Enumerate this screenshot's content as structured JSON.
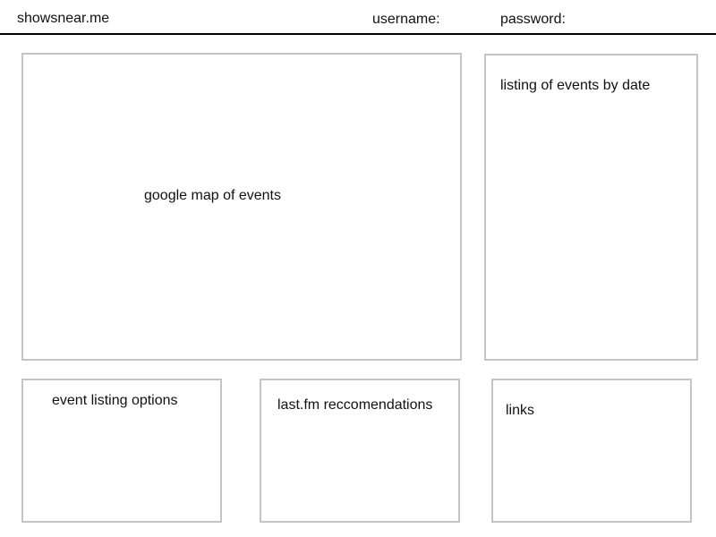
{
  "header": {
    "site_name": "showsnear.me",
    "username_label": "username:",
    "password_label": "password:"
  },
  "panels": {
    "map": "google map of events",
    "event_listing": "listing of events by date",
    "options": "event listing options",
    "recommendations": "last.fm reccomendations",
    "links": "links"
  },
  "colors": {
    "header_rule": "#000000",
    "panel_border": "#c4c4c4"
  }
}
